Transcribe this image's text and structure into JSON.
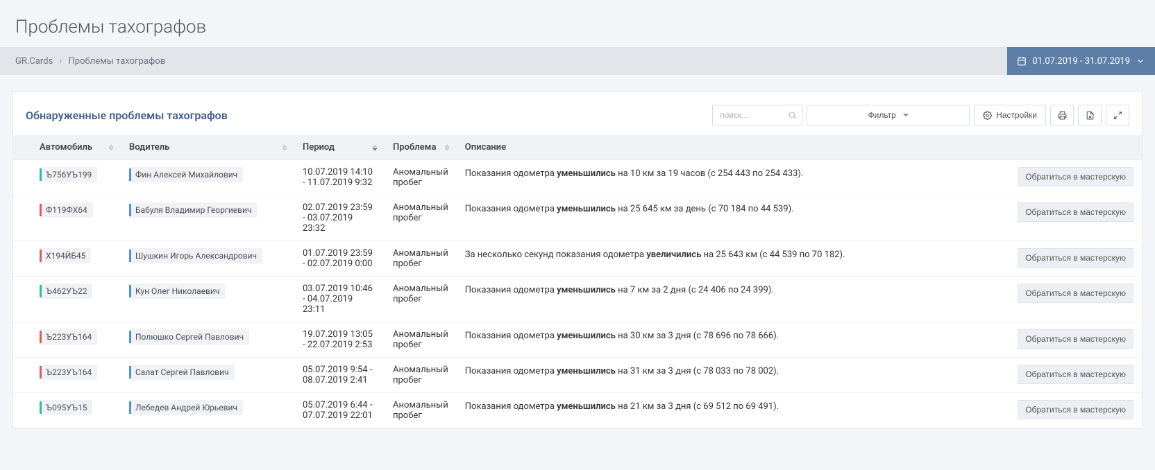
{
  "page_title": "Проблемы тахографов",
  "breadcrumb": {
    "root": "GR.Cards",
    "current": "Проблемы тахографов"
  },
  "date_range": "01.07.2019 - 31.07.2019",
  "panel_title": "Обнаруженные проблемы тахографов",
  "search_placeholder": "поиск...",
  "filter_label": "Фильтр",
  "settings_label": "Настройки",
  "columns": {
    "vehicle": "Автомобиль",
    "driver": "Водитель",
    "period": "Период",
    "problem": "Проблема",
    "description": "Описание"
  },
  "action_label": "Обратиться в мастерскую",
  "rows": [
    {
      "vehicle": "Ъ756УЪ199",
      "v_color": "teal",
      "driver": "Фин Алексей Михайлович",
      "d_color": "blue",
      "period": "10.07.2019 14:10 - 11.07.2019 9:32",
      "problem": "Аномальный пробег",
      "desc_pre": "Показания одометра ",
      "desc_bold": "уменьшились",
      "desc_post": " на 10 км за 19 часов (с 254 443 по 254 433)."
    },
    {
      "vehicle": "Ф119ФХ64",
      "v_color": "red",
      "driver": "Бабуля Владимир Георгиевич",
      "d_color": "blue",
      "period": "02.07.2019 23:59 - 03.07.2019 23:32",
      "problem": "Аномальный пробег",
      "desc_pre": "Показания одометра ",
      "desc_bold": "уменьшились",
      "desc_post": " на 25 645 км за день (с 70 184 по 44 539)."
    },
    {
      "vehicle": "Х194ЙБ45",
      "v_color": "red",
      "driver": "Шушкин Игорь Александрович",
      "d_color": "blue",
      "period": "01.07.2019 23:59 - 02.07.2019 0:00",
      "problem": "Аномальный пробег",
      "desc_pre": "За несколько секунд показания одометра ",
      "desc_bold": "увеличились",
      "desc_post": " на 25 643 км (с 44 539 по 70 182)."
    },
    {
      "vehicle": "Ъ462УЪ22",
      "v_color": "teal",
      "driver": "Кун Олег Николаевич",
      "d_color": "blue",
      "period": "03.07.2019 10:46 - 04.07.2019 23:11",
      "problem": "Аномальный пробег",
      "desc_pre": "Показания одометра ",
      "desc_bold": "уменьшились",
      "desc_post": " на 7 км за 2 дня (с 24 406 по 24 399)."
    },
    {
      "vehicle": "Ъ223УЪ164",
      "v_color": "red",
      "driver": "Полюшко Сергей Павлович",
      "d_color": "blue",
      "period": "19.07.2019 13:05 - 22.07.2019 2:53",
      "problem": "Аномальный пробег",
      "desc_pre": "Показания одометра ",
      "desc_bold": "уменьшились",
      "desc_post": " на 30 км за 3 дня (с 78 696 по 78 666)."
    },
    {
      "vehicle": "Ъ223УЪ164",
      "v_color": "red",
      "driver": "Салат Сергей Павлович",
      "d_color": "blue",
      "period": "05.07.2019 9:54 - 08.07.2019 2:41",
      "problem": "Аномальный пробег",
      "desc_pre": "Показания одометра ",
      "desc_bold": "уменьшились",
      "desc_post": " на 31 км за 3 дня (с 78 033 по 78 002)."
    },
    {
      "vehicle": "Ъ095УЪ15",
      "v_color": "teal",
      "driver": "Лебедев Андрей Юрьевич",
      "d_color": "blue",
      "period": "05.07.2019 6:44 - 07.07.2019 22:01",
      "problem": "Аномальный пробег",
      "desc_pre": "Показания одометра ",
      "desc_bold": "уменьшились",
      "desc_post": " на 21 км за 3 дня (с 69 512 по 69 491)."
    }
  ]
}
